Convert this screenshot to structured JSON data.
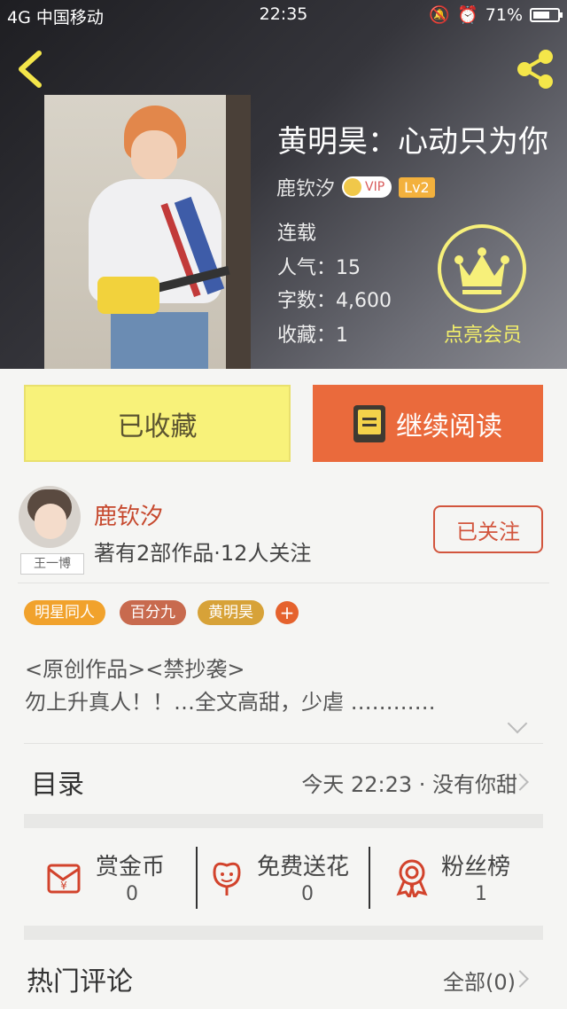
{
  "status_bar": {
    "carrier": "4G 中国移动",
    "time": "22:35",
    "battery": "71%",
    "battery_level": 0.71
  },
  "book": {
    "title": "黄明昊：心动只为你",
    "author": "鹿钦汐",
    "vip_badge": "VIP",
    "level": "Lv2",
    "status": "连载",
    "popularity": "人气：15",
    "word_count": "字数：4,600",
    "favorites": "收藏：1",
    "member_label": "点亮会员"
  },
  "actions": {
    "collected": "已收藏",
    "continue_reading": "继续阅读"
  },
  "author_section": {
    "avatar_caption": "王一博",
    "name": "鹿钦汐",
    "meta": "著有2部作品·12人关注",
    "follow_label": "已关注"
  },
  "tags": [
    {
      "label": "明星同人",
      "color": "#f1a22c"
    },
    {
      "label": "百分九",
      "color": "#c86a4e"
    },
    {
      "label": "黄明昊",
      "color": "#d7a238"
    }
  ],
  "tag_add": "+",
  "intro": {
    "line1": "<原创作品><禁抄袭>",
    "line2": "勿上升真人！！…全文高甜，少虐 …………"
  },
  "toc": {
    "label": "目录",
    "latest": "今天 22:23 · 没有你甜"
  },
  "stats": [
    {
      "title": "赏金币",
      "value": "0"
    },
    {
      "title": "免费送花",
      "value": "0"
    },
    {
      "title": "粉丝榜",
      "value": "1"
    }
  ],
  "comments": {
    "title": "热门评论",
    "all_label": "全部(0)"
  },
  "colors": {
    "accent_orange": "#ea6a3c",
    "collected_yellow": "#f8f27a",
    "author_red": "#c6482d",
    "member_yellow": "#f7f07a"
  }
}
